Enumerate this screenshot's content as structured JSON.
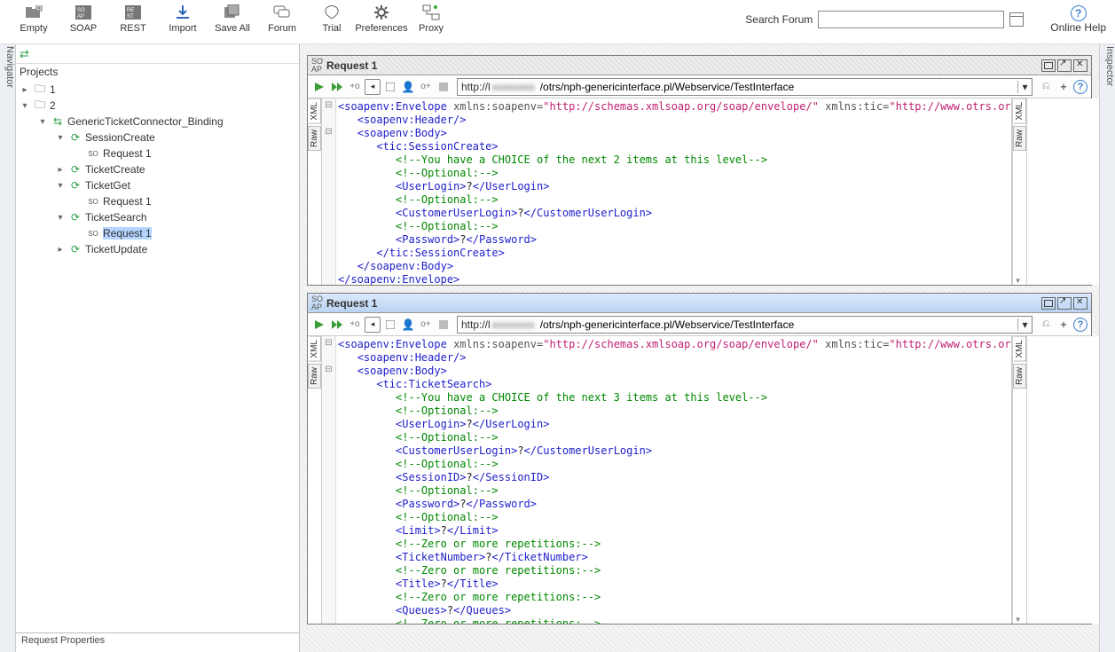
{
  "toolbar": {
    "empty": "Empty",
    "soap": "SOAP",
    "rest": "REST",
    "import": "Import",
    "saveall": "Save All",
    "forum": "Forum",
    "trial": "Trial",
    "preferences": "Preferences",
    "proxy": "Proxy",
    "search_label": "Search Forum",
    "search_value": "",
    "help": "Online Help"
  },
  "nav": {
    "strip": "Navigator",
    "title": "Projects",
    "nodes": {
      "p1": "1",
      "p2": "2",
      "binding": "GenericTicketConnector_Binding",
      "op_session_create": "SessionCreate",
      "op_session_create_r1": "Request 1",
      "op_ticket_create": "TicketCreate",
      "op_ticket_get": "TicketGet",
      "op_ticket_get_r1": "Request 1",
      "op_ticket_search": "TicketSearch",
      "op_ticket_search_r1": "Request 1",
      "op_ticket_update": "TicketUpdate"
    },
    "props": "Request Properties"
  },
  "inspector": {
    "strip": "Inspector"
  },
  "windows": [
    {
      "title": "Request 1",
      "active": false,
      "url_prefix": "http://l",
      "url_blur": "xxxxxxxx",
      "url_suffix": "/otrs/nph-genericinterface.pl/Webservice/TestInterface",
      "tabs": [
        "XML",
        "Raw"
      ],
      "resp_tabs": [
        "XML",
        "Raw"
      ],
      "code": {
        "operation": "tic:SessionCreate",
        "comments": [
          "You have a CHOICE of the next 2 items at this level",
          "Optional:",
          "Optional:",
          "Optional:"
        ],
        "fields": [
          {
            "name": "UserLogin",
            "val": "?"
          },
          {
            "name": "CustomerUserLogin",
            "val": "?"
          },
          {
            "name": "Password",
            "val": "?"
          }
        ]
      }
    },
    {
      "title": "Request 1",
      "active": true,
      "url_prefix": "http://l",
      "url_blur": "xxxxxxxx",
      "url_suffix": "/otrs/nph-genericinterface.pl/Webservice/TestInterface",
      "tabs": [
        "XML",
        "Raw"
      ],
      "resp_tabs": [
        "XML",
        "Raw"
      ],
      "code": {
        "operation": "tic:TicketSearch",
        "comments": [
          "You have a CHOICE of the next 3 items at this level",
          "Optional:",
          "Optional:",
          "Optional:",
          "Optional:",
          "Optional:",
          "Zero or more repetitions:",
          "Zero or more repetitions:",
          "Zero or more repetitions:",
          "Zero or more repetitions:"
        ],
        "fields": [
          {
            "name": "UserLogin",
            "val": "?"
          },
          {
            "name": "CustomerUserLogin",
            "val": "?"
          },
          {
            "name": "SessionID",
            "val": "?"
          },
          {
            "name": "Password",
            "val": "?"
          },
          {
            "name": "Limit",
            "val": "?"
          },
          {
            "name": "TicketNumber",
            "val": "?"
          },
          {
            "name": "Title",
            "val": "?"
          },
          {
            "name": "Queues",
            "val": "?"
          }
        ]
      }
    }
  ]
}
